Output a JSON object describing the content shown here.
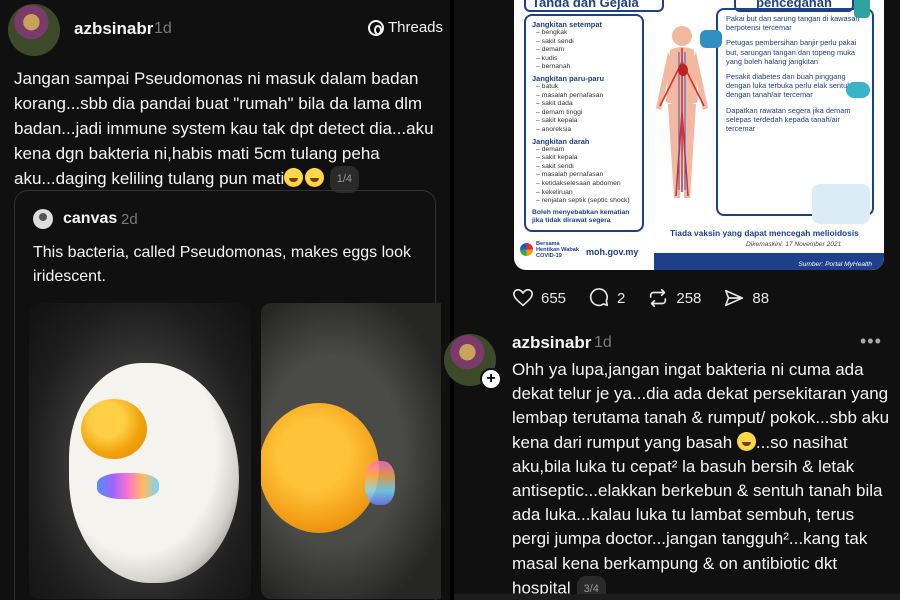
{
  "left_post": {
    "author": "azbsinabr",
    "time": "1d",
    "threads_label": "Threads",
    "text": "Jangan sampai Pseudomonas ni masuk dalam badan korang...sbb dia pandai buat \"rumah\" bila da lama dlm badan...jadi immune system kau tak dpt detect dia...aku kena dgn bakteria ni,habis mati 5cm tulang peha aku...daging keliling tulang pun mati",
    "page": "1/4",
    "quote": {
      "author": "canvas",
      "time": "2d",
      "text": "This bacteria, called Pseudomonas, makes eggs look iridescent."
    }
  },
  "infographic": {
    "heading_left": "Tanda dan Gejala",
    "heading_right": "pencegahan",
    "sections": [
      {
        "title": "Jangkitan setempat",
        "items": [
          "bengkak",
          "sakit sendi",
          "demam",
          "kudis",
          "bernanah"
        ]
      },
      {
        "title": "Jangkitan paru-paru",
        "items": [
          "batuk",
          "masalah pernafasan",
          "sakit dada",
          "demam tinggi",
          "sakit kepala",
          "anoreksia"
        ]
      },
      {
        "title": "Jangkitan darah",
        "items": [
          "demam",
          "sakit kepala",
          "sakit sendi",
          "masalah pernafasan",
          "ketidakselesaan abdomen",
          "kekeliruan",
          "renjatan septik (septic shock)"
        ]
      }
    ],
    "note_left": "Boleh menyebabkan kematian jika tidak dirawat segera",
    "prevention": [
      "Pakai but dan sarung tangan di kawasan berpotensi tercemar",
      "Petugas pembersihan banjir perlu pakai but, sarungan tangan dan topeng muka yang boleh halang jangkitan",
      "Pesakit diabetes dan buah pinggang dengan luka terbuka perlu elak sentuhan dengan tanah/air tercemar",
      "Dapatkan rawatan segera jika demam selepas terdedah kepada tanah/air tercemar"
    ],
    "bottom_note": "Tiada vaksin yang dapat mencegah melioidosis",
    "updated": "Dikemaskini: 17 November 2021",
    "brand": "Bersama Hentikan Wabak COVID-19",
    "site": "moh.gov.my",
    "source": "Sumber: Portal MyHealth"
  },
  "actions": {
    "likes": "655",
    "replies": "2",
    "reposts": "258",
    "shares": "88"
  },
  "reply": {
    "author": "azbsinabr",
    "time": "1d",
    "more": "•••",
    "text_a": "Ohh ya lupa,jangan ingat bakteria ni cuma ada dekat telur je ya...dia ada dekat persekitaran yang lembap terutama tanah & rumput/ pokok...sbb aku kena dari rumput yang basah ",
    "text_b": "...so nasihat aku,bila luka tu cepat² la basuh bersih & letak antiseptic...elakkan berkebun & sentuh tanah bila ada luka...kalau luka tu lambat sembuh, terus pergi jumpa doctor...jangan tangguh²...kang tak masal kena berkampung & on antibiotic dkt hospital",
    "page": "3/4"
  },
  "icons": {
    "threads": "threads-logo-icon",
    "like": "heart-icon",
    "reply": "comment-icon",
    "repost": "repost-icon",
    "share": "send-icon",
    "emoji": "rolling-on-floor-laughing-emoji"
  }
}
